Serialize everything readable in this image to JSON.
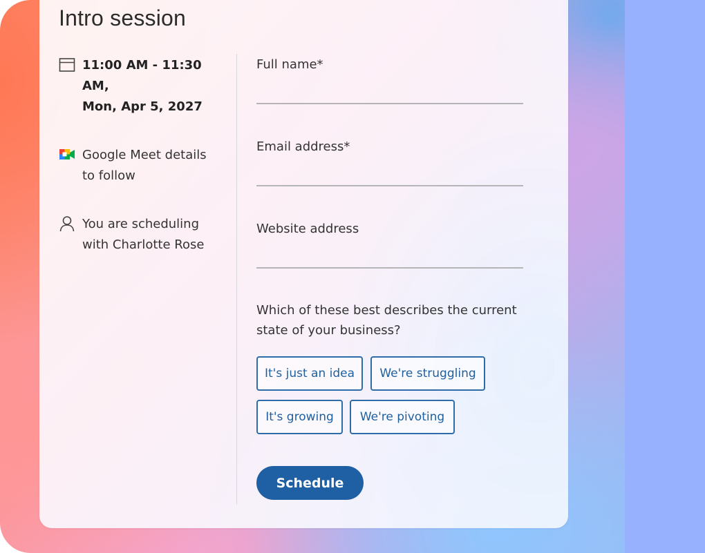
{
  "event": {
    "title": "Intro session",
    "time_line1": "11:00 AM - 11:30 AM,",
    "time_line2": "Mon, Apr 5, 2027",
    "meet_line1": "Google Meet details",
    "meet_line2": "to follow",
    "host_line1": "You are scheduling",
    "host_line2": "with Charlotte Rose"
  },
  "icons": {
    "calendar": "calendar-icon",
    "meet": "google-meet-icon",
    "person": "person-icon"
  },
  "form": {
    "full_name_label": "Full name*",
    "full_name_value": "",
    "email_label": "Email address*",
    "email_value": "",
    "website_label": "Website address",
    "website_value": "",
    "question_line1": "Which of these best describes the current",
    "question_line2": "state of your business?",
    "options": [
      "It's just an idea",
      "We're struggling",
      "It's growing",
      "We're pivoting"
    ],
    "schedule_label": "Schedule"
  },
  "colors": {
    "accent": "#1f60a4",
    "chip_border": "#2d6ca8",
    "chip_text": "#1f5f9e",
    "text": "#333333"
  }
}
